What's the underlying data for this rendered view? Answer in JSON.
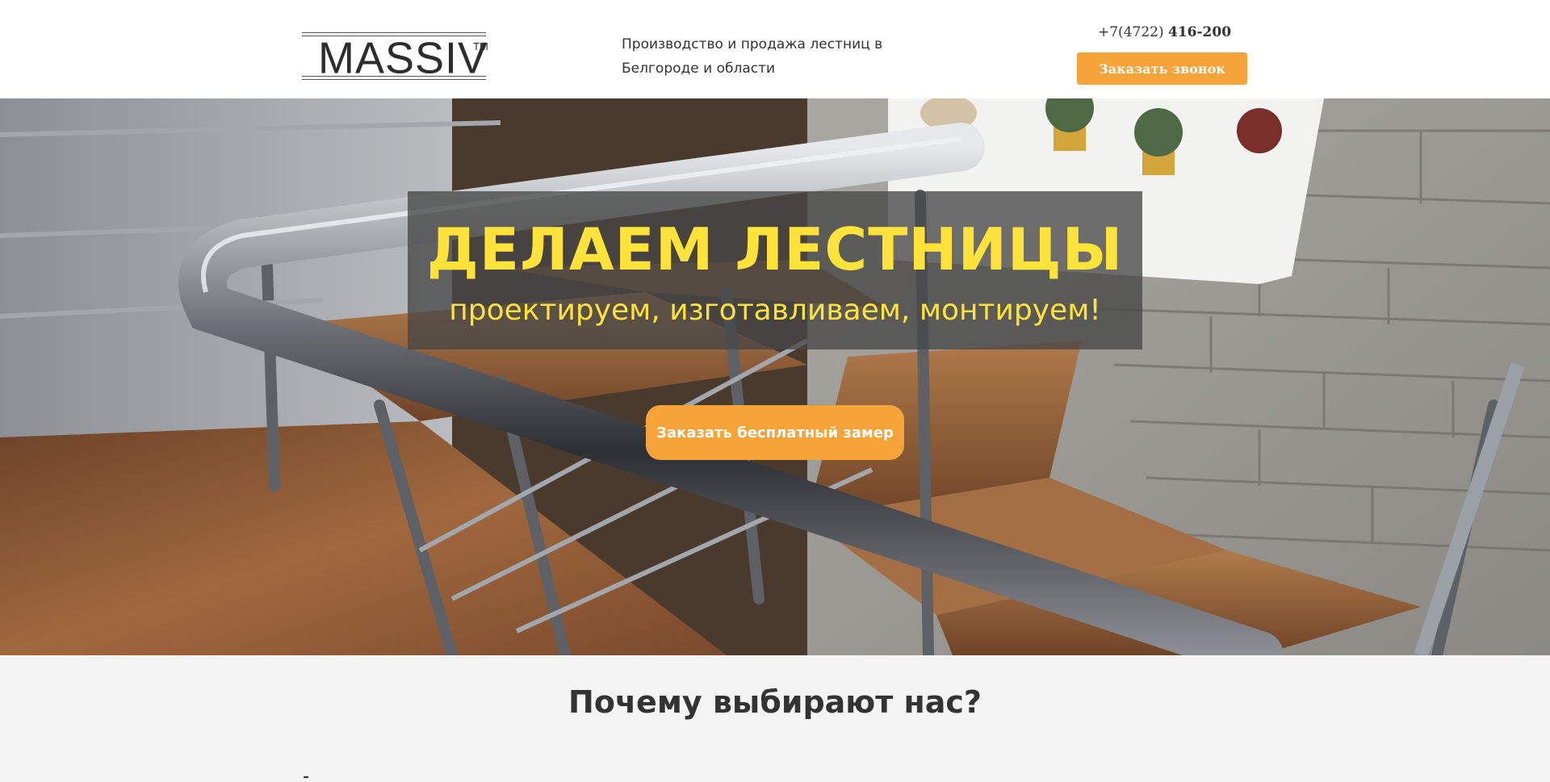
{
  "header": {
    "logo_text": "MASSIV",
    "logo_tm": "TM",
    "tagline_line1": "Производство и продажа лестниц в",
    "tagline_line2": "Белгороде и области",
    "phone_prefix": "+7(4722) ",
    "phone_number": "416-200",
    "callback_button": "Заказать звонок"
  },
  "hero": {
    "title": "ДЕЛАЕМ ЛЕСТНИЦЫ",
    "subtitle": "проектируем, изготавливаем, монтируем!",
    "measure_button": "Заказать бесплатный замер"
  },
  "why": {
    "title": "Почему выбирают нас?"
  },
  "colors": {
    "accent": "#f6a43a",
    "hero_text": "#ffe23a",
    "header_bg": "#ffffff",
    "section_bg": "#f4f4f4"
  }
}
